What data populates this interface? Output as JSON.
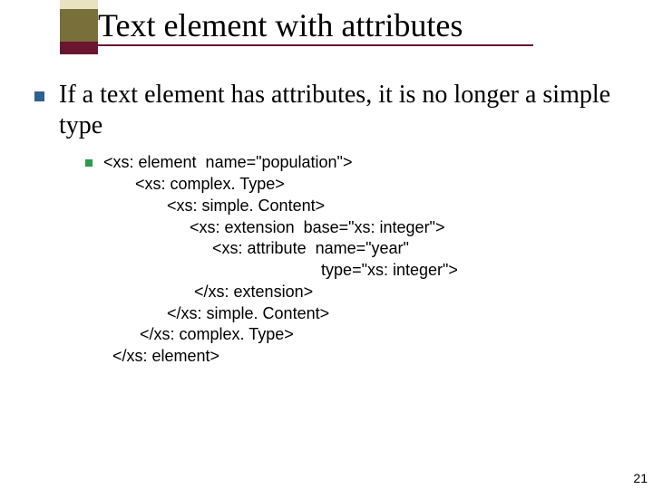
{
  "title": "Text element with attributes",
  "bullet1": "If a text element has attributes, it is no longer a simple type",
  "code": {
    "l1": "<xs: element  name=\"population\">",
    "l2": "       <xs: complex. Type>",
    "l3": "              <xs: simple. Content>",
    "l4": "                   <xs: extension  base=\"xs: integer\">",
    "l5": "                        <xs: attribute  name=\"year\"",
    "l6": "                                                type=\"xs: integer\">",
    "l7": "                    </xs: extension>",
    "l8": "              </xs: simple. Content>",
    "l9": "        </xs: complex. Type>",
    "l10": "  </xs: element>"
  },
  "page_number": "21"
}
